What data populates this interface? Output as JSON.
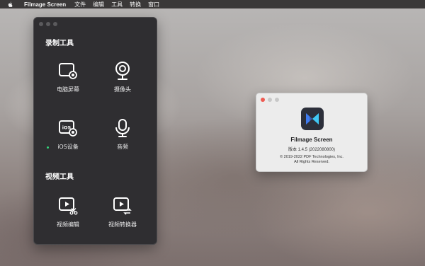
{
  "menubar": {
    "app_name": "Filmage Screen",
    "items": [
      "文件",
      "编辑",
      "工具",
      "转换",
      "窗口"
    ]
  },
  "tool_window": {
    "record_section": "录制工具",
    "video_section": "视频工具",
    "tools": {
      "screen": "电脑屏幕",
      "camera": "摄像头",
      "ios": "iOS设备",
      "audio": "音频",
      "edit": "视频编辑",
      "convert": "视频转换器"
    }
  },
  "about": {
    "name": "Filmage Screen",
    "version": "版本 1.4.5 (2022080800)",
    "copyright_line1": "© 2019-2022 PDF Technologies, Inc.",
    "copyright_line2": "All Rights Reserved."
  },
  "colors": {
    "window_bg": "#2f2e31",
    "accent_green": "#33d17a",
    "app_icon_bg": "#2c2f3a",
    "app_icon_blue": "#3f7cf0",
    "app_icon_cyan": "#40c8f4"
  }
}
